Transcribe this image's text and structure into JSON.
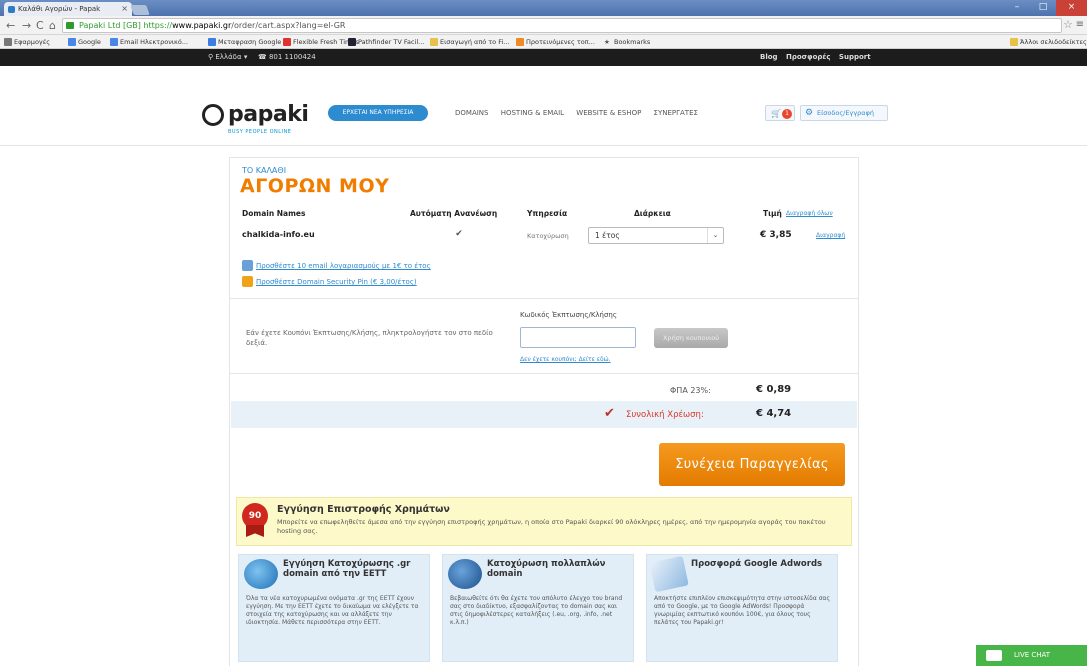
{
  "browser": {
    "tab_title": "Καλάθι Αγορών - Papak",
    "url_https": "https://",
    "url_host": "www.papaki.gr",
    "url_path": "/order/cart.aspx?lang=el-GR",
    "url_badge": "Papaki Ltd [GB]",
    "bookmarks": [
      "Εφαρμογές",
      "Google",
      "Email Ηλεκτρονικό...",
      "Μεταφραση Google",
      "Flexible Fresh Times",
      "Pathfinder TV Facil...",
      "Εισαγωγή από το Fi...",
      "Προτεινόμενες τοπ...",
      "Bookmarks"
    ],
    "other_bookmarks": "Άλλοι σελιδοδείκτες"
  },
  "topbar": {
    "location": "Ελλάδα",
    "phone": "801 1100424",
    "links": [
      "Blog",
      "Προσφορές",
      "Support"
    ]
  },
  "header": {
    "logo_text": "papaki",
    "logo_tag": "BUSY PEOPLE ONLINE",
    "promo": "ΕΡΧΕΤΑΙ ΝΕΑ ΥΠΗΡΕΣΙΑ",
    "nav": [
      "DOMAINS",
      "HOSTING & EMAIL",
      "WEBSITE & ESHOP",
      "ΣΥΝΕΡΓΑΤΕΣ"
    ],
    "cart_count": "1",
    "login": "Είσοδος/Εγγραφή"
  },
  "cart": {
    "title_small": "ΤΟ ΚΑΛΑΘΙ",
    "title_big": "ΑΓΟΡΩΝ ΜΟΥ",
    "columns": {
      "domain": "Domain Names",
      "auto_renew": "Αυτόματη Ανανέωση",
      "service": "Υπηρεσία",
      "duration": "Διάρκεια",
      "price": "Τιμή",
      "remove_all": "Διαγραφή όλων"
    },
    "item": {
      "domain": "chalkida-info.eu",
      "service": "Κατοχύρωση",
      "duration": "1 έτος",
      "price": "€ 3,85",
      "remove": "Διαγραφή"
    },
    "addons": [
      "Προσθέστε 10 email λογαριασμούς με 1€ το έτος",
      "Προσθέστε Domain Security Pin (€ 3,00/έτος)"
    ],
    "coupon": {
      "text": "Εάν έχετε Κουπόνι Έκπτωσης/Κλήσης, πληκτρολογήστε τον στο πεδίο δεξιά.",
      "label": "Κωδικός Έκπτωσης/Κλήσης",
      "button": "Χρήση κουπονιού",
      "link": "Δεν έχετε κουπόνι; Δείτε εδώ."
    },
    "vat_label": "ΦΠΑ 23%:",
    "vat_value": "€ 0,89",
    "total_label": "Συνολική Χρέωση:",
    "total_value": "€ 4,74",
    "continue_button": "Συνέχεια Παραγγελίας"
  },
  "guarantee": {
    "badge": "90",
    "title": "Εγγύηση Επιστροφής Χρημάτων",
    "text": "Μπορείτε να επωφεληθείτε άμεσα από την εγγύηση επιστροφής χρημάτων, η οποία στο Papaki διαρκεί 90 ολόκληρες ημέρες, από την ημερομηνία αγοράς του πακέτου hosting σας."
  },
  "features": [
    {
      "title": "Εγγύηση Κατοχύρωσης .gr domain από την ΕΕΤΤ",
      "text": "Όλα τα νέα κατοχυρωμένα ονόματα .gr της ΕΕΤΤ έχουν εγγύηση. Με την ΕΕΤΤ έχετε το δικαίωμα να ελέγξετε τα στοιχεία της κατοχύρωσης και να αλλάξετε την ιδιοκτησία. Μάθετε περισσότερα στην ΕΕΤΤ."
    },
    {
      "title": "Κατοχύρωση πολλαπλών domain",
      "text": "Βεβαιωθείτε ότι θα έχετε τον απόλυτο έλεγχο του brand σας στο διαδίκτυο, εξασφαλίζοντας το domain σας και στις δημοφιλέστερες καταλήξεις (.eu, .org, .info, .net κ.λ.π.)"
    },
    {
      "title": "Προσφορά Google Adwords",
      "text": "Αποκτήστε επιπλέον επισκεψιμότητα στην ιστοσελίδα σας από το Google, με το Google AdWords! Προσφορά γνωριμίας εκπτωτικό κουπόνι 100€, για όλους τους πελάτες του Papaki.gr!"
    }
  ],
  "livechat": "LIVE CHAT",
  "colors": {
    "accent_orange": "#f07d00",
    "link_blue": "#2d8bd0",
    "total_red": "#d9382b",
    "livechat_green": "#48b548"
  }
}
